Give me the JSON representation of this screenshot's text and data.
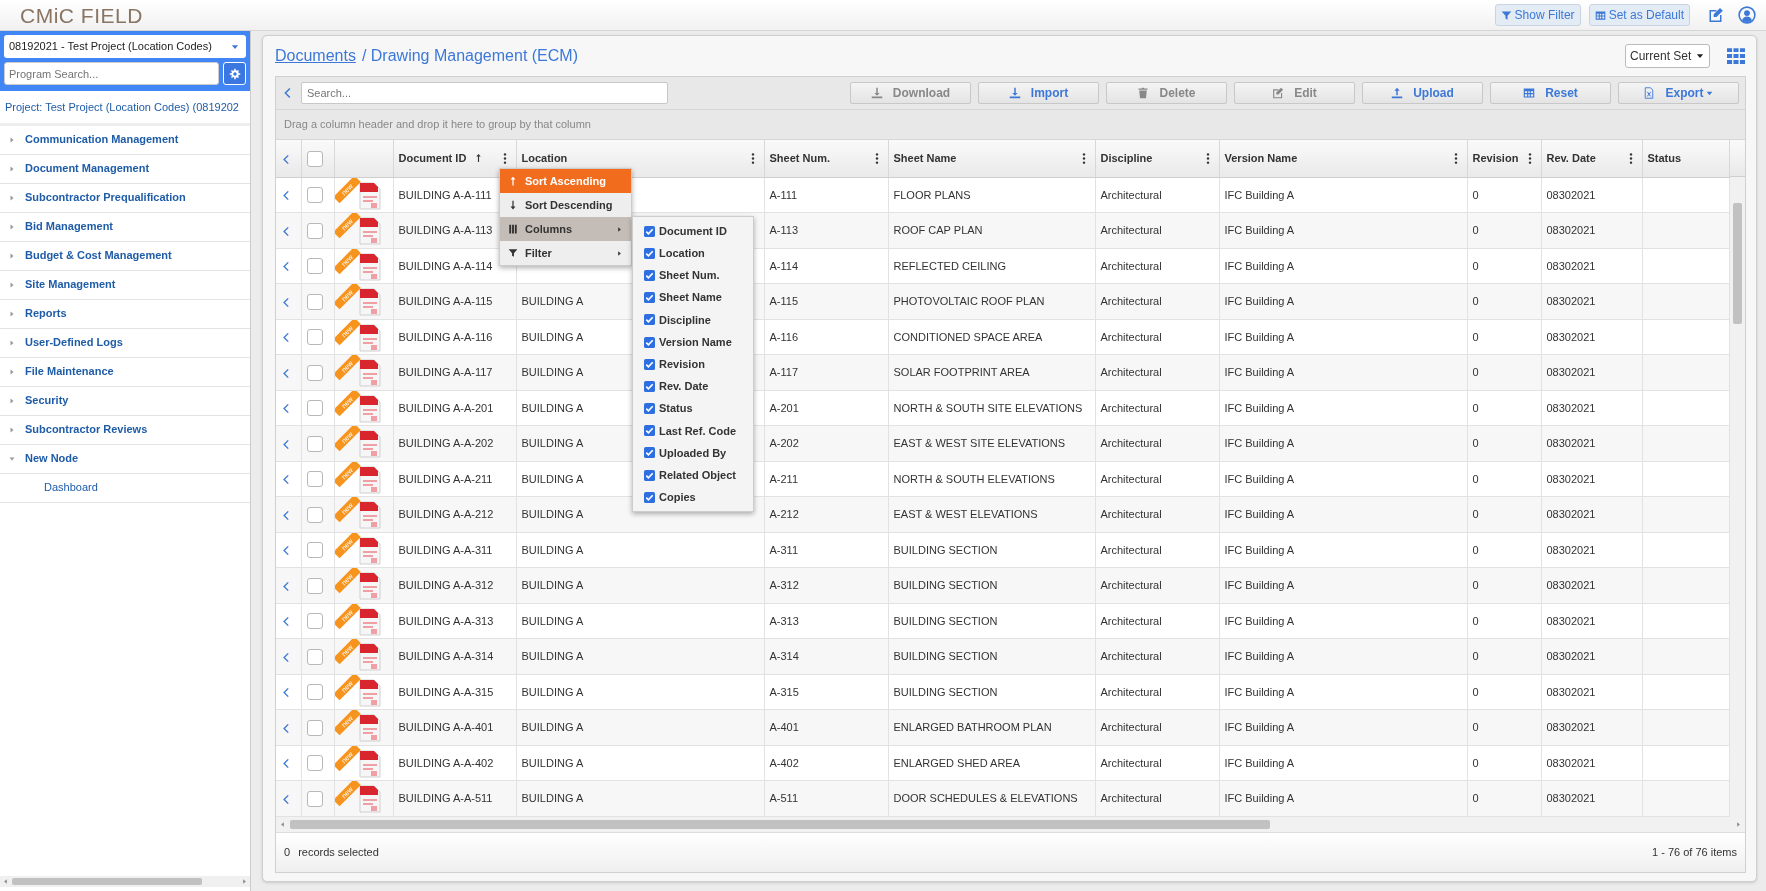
{
  "header": {
    "logo": "CMiC FIELD",
    "buttons": [
      {
        "label": "Show Filter"
      },
      {
        "label": "Set as Default"
      }
    ]
  },
  "sidebar": {
    "project_select": "08192021 - Test Project (Location Codes)",
    "search": {
      "placeholder": "Program Search..."
    },
    "project_label": "Project: Test Project (Location Codes) (0819202",
    "items": [
      {
        "label": "Communication Management",
        "expanded": false
      },
      {
        "label": "Document Management",
        "expanded": false
      },
      {
        "label": "Subcontractor Prequalification",
        "expanded": false
      },
      {
        "label": "Bid Management",
        "expanded": false
      },
      {
        "label": "Budget & Cost Management",
        "expanded": false
      },
      {
        "label": "Site Management",
        "expanded": false
      },
      {
        "label": "Reports",
        "expanded": false
      },
      {
        "label": "User-Defined Logs",
        "expanded": false
      },
      {
        "label": "File Maintenance",
        "expanded": false
      },
      {
        "label": "Security",
        "expanded": false
      },
      {
        "label": "Subcontractor Reviews",
        "expanded": false
      },
      {
        "label": "New Node",
        "expanded": true,
        "children": [
          {
            "label": "Dashboard"
          }
        ]
      }
    ]
  },
  "breadcrumb": {
    "link": "Documents",
    "current": "/ Drawing Management (ECM)"
  },
  "view_select": "Current Set",
  "search": {
    "placeholder": "Search..."
  },
  "toolbar": [
    {
      "label": "Download",
      "disabled": true
    },
    {
      "label": "Import",
      "disabled": false
    },
    {
      "label": "Delete",
      "disabled": true
    },
    {
      "label": "Edit",
      "disabled": true
    },
    {
      "label": "Upload",
      "disabled": false
    },
    {
      "label": "Reset",
      "disabled": false
    },
    {
      "label": "Export",
      "disabled": false,
      "dropdown": true
    }
  ],
  "group_hint": "Drag a column header and drop it here to group by that column",
  "table": {
    "select_all_checked": false,
    "columns": [
      {
        "label": "Document ID",
        "sorted": true,
        "menu_button": true
      },
      {
        "label": "Location",
        "sorted": false,
        "menu_button": true
      },
      {
        "label": "Sheet Num.",
        "sorted": false,
        "menu_button": true
      },
      {
        "label": "Sheet Name",
        "sorted": false,
        "menu_button": true
      },
      {
        "label": "Discipline",
        "sorted": false,
        "menu_button": true
      },
      {
        "label": "Version Name",
        "sorted": false,
        "menu_button": true
      },
      {
        "label": "Revision",
        "sorted": false,
        "menu_button": true
      },
      {
        "label": "Rev. Date",
        "sorted": false,
        "menu_button": true
      },
      {
        "label": "Status",
        "sorted": false,
        "menu_button": false
      }
    ],
    "rows": [
      {
        "badge": "new",
        "checked": false,
        "document_id": "BUILDING A-A-111",
        "sheet_num": "A-111",
        "sheet_name": "FLOOR PLANS",
        "discipline": "Architectural",
        "version_name": "IFC Building A",
        "revision": "0",
        "rev_date": "08302021"
      },
      {
        "badge": "new",
        "checked": false,
        "document_id": "BUILDING A-A-113",
        "sheet_num": "A-113",
        "sheet_name": "ROOF CAP PLAN",
        "discipline": "Architectural",
        "version_name": "IFC Building A",
        "revision": "0",
        "rev_date": "08302021"
      },
      {
        "badge": "new",
        "checked": false,
        "document_id": "BUILDING A-A-114",
        "sheet_num": "A-114",
        "sheet_name": "REFLECTED CEILING",
        "discipline": "Architectural",
        "version_name": "IFC Building A",
        "revision": "0",
        "rev_date": "08302021"
      },
      {
        "badge": "new",
        "checked": false,
        "document_id": "BUILDING A-A-115",
        "location": "BUILDING A",
        "sheet_num": "A-115",
        "sheet_name": "PHOTOVOLTAIC ROOF PLAN",
        "discipline": "Architectural",
        "version_name": "IFC Building A",
        "revision": "0",
        "rev_date": "08302021"
      },
      {
        "badge": "new",
        "checked": false,
        "document_id": "BUILDING A-A-116",
        "location": "BUILDING A",
        "sheet_num": "A-116",
        "sheet_name": "CONDITIONED SPACE AREA",
        "discipline": "Architectural",
        "version_name": "IFC Building A",
        "revision": "0",
        "rev_date": "08302021"
      },
      {
        "badge": "new",
        "checked": false,
        "document_id": "BUILDING A-A-117",
        "location": "BUILDING A",
        "sheet_num": "A-117",
        "sheet_name": "SOLAR FOOTPRINT AREA",
        "discipline": "Architectural",
        "version_name": "IFC Building A",
        "revision": "0",
        "rev_date": "08302021"
      },
      {
        "badge": "new",
        "checked": false,
        "document_id": "BUILDING A-A-201",
        "location": "BUILDING A",
        "sheet_num": "A-201",
        "sheet_name": "NORTH & SOUTH SITE ELEVATIONS",
        "discipline": "Architectural",
        "version_name": "IFC Building A",
        "revision": "0",
        "rev_date": "08302021"
      },
      {
        "badge": "new",
        "checked": false,
        "document_id": "BUILDING A-A-202",
        "location": "BUILDING A",
        "sheet_num": "A-202",
        "sheet_name": "EAST & WEST SITE ELEVATIONS",
        "discipline": "Architectural",
        "version_name": "IFC Building A",
        "revision": "0",
        "rev_date": "08302021"
      },
      {
        "badge": "new",
        "checked": false,
        "document_id": "BUILDING A-A-211",
        "location": "BUILDING A",
        "sheet_num": "A-211",
        "sheet_name": "NORTH & SOUTH ELEVATIONS",
        "discipline": "Architectural",
        "version_name": "IFC Building A",
        "revision": "0",
        "rev_date": "08302021"
      },
      {
        "badge": "new",
        "checked": false,
        "document_id": "BUILDING A-A-212",
        "location": "BUILDING A",
        "sheet_num": "A-212",
        "sheet_name": "EAST & WEST ELEVATIONS",
        "discipline": "Architectural",
        "version_name": "IFC Building A",
        "revision": "0",
        "rev_date": "08302021"
      },
      {
        "badge": "new",
        "checked": false,
        "document_id": "BUILDING A-A-311",
        "location": "BUILDING A",
        "sheet_num": "A-311",
        "sheet_name": "BUILDING SECTION",
        "discipline": "Architectural",
        "version_name": "IFC Building A",
        "revision": "0",
        "rev_date": "08302021"
      },
      {
        "badge": "new",
        "checked": false,
        "document_id": "BUILDING A-A-312",
        "location": "BUILDING A",
        "sheet_num": "A-312",
        "sheet_name": "BUILDING SECTION",
        "discipline": "Architectural",
        "version_name": "IFC Building A",
        "revision": "0",
        "rev_date": "08302021"
      },
      {
        "badge": "new",
        "checked": false,
        "document_id": "BUILDING A-A-313",
        "location": "BUILDING A",
        "sheet_num": "A-313",
        "sheet_name": "BUILDING SECTION",
        "discipline": "Architectural",
        "version_name": "IFC Building A",
        "revision": "0",
        "rev_date": "08302021"
      },
      {
        "badge": "new",
        "checked": false,
        "document_id": "BUILDING A-A-314",
        "location": "BUILDING A",
        "sheet_num": "A-314",
        "sheet_name": "BUILDING SECTION",
        "discipline": "Architectural",
        "version_name": "IFC Building A",
        "revision": "0",
        "rev_date": "08302021"
      },
      {
        "badge": "new",
        "checked": false,
        "document_id": "BUILDING A-A-315",
        "location": "BUILDING A",
        "sheet_num": "A-315",
        "sheet_name": "BUILDING SECTION",
        "discipline": "Architectural",
        "version_name": "IFC Building A",
        "revision": "0",
        "rev_date": "08302021"
      },
      {
        "badge": "new",
        "checked": false,
        "document_id": "BUILDING A-A-401",
        "location": "BUILDING A",
        "sheet_num": "A-401",
        "sheet_name": "ENLARGED BATHROOM PLAN",
        "discipline": "Architectural",
        "version_name": "IFC Building A",
        "revision": "0",
        "rev_date": "08302021"
      },
      {
        "badge": "new",
        "checked": false,
        "document_id": "BUILDING A-A-402",
        "location": "BUILDING A",
        "sheet_num": "A-402",
        "sheet_name": "ENLARGED SHED AREA",
        "discipline": "Architectural",
        "version_name": "IFC Building A",
        "revision": "0",
        "rev_date": "08302021"
      },
      {
        "badge": "new",
        "checked": false,
        "document_id": "BUILDING A-A-511",
        "location": "BUILDING A",
        "sheet_num": "A-511",
        "sheet_name": "DOOR SCHEDULES & ELEVATIONS",
        "discipline": "Architectural",
        "version_name": "IFC Building A",
        "revision": "0",
        "rev_date": "08302021"
      }
    ]
  },
  "column_menu": {
    "items": [
      {
        "label": "Sort Ascending",
        "selected": true,
        "expanded": false
      },
      {
        "label": "Sort Descending",
        "selected": false,
        "expanded": false
      },
      {
        "label": "Columns",
        "selected": false,
        "expanded": true,
        "submenu": true
      },
      {
        "label": "Filter",
        "selected": false,
        "expanded": false,
        "submenu": true
      }
    ],
    "columns_submenu": [
      {
        "label": "Document ID",
        "checked": true
      },
      {
        "label": "Location",
        "checked": true
      },
      {
        "label": "Sheet Num.",
        "checked": true
      },
      {
        "label": "Sheet Name",
        "checked": true
      },
      {
        "label": "Discipline",
        "checked": true
      },
      {
        "label": "Version Name",
        "checked": true
      },
      {
        "label": "Revision",
        "checked": true
      },
      {
        "label": "Rev. Date",
        "checked": true
      },
      {
        "label": "Status",
        "checked": true
      },
      {
        "label": "Last Ref. Code",
        "checked": true
      },
      {
        "label": "Uploaded By",
        "checked": true
      },
      {
        "label": "Related Object",
        "checked": true
      },
      {
        "label": "Copies",
        "checked": true
      }
    ]
  },
  "footer": {
    "selected_count": "0",
    "selected_label": "records selected",
    "paging": "1 - 76 of 76 items"
  }
}
